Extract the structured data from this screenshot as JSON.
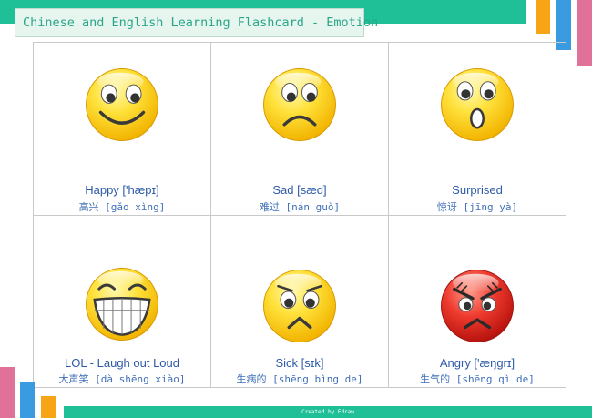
{
  "theme": {
    "teal": "#1fbf98",
    "orange": "#f7a517",
    "blue": "#3b9be0",
    "pink": "#e0729a"
  },
  "title": "Chinese and English Learning Flashcard - Emotion",
  "footer": "Created by Edraw",
  "cards": [
    {
      "icon": "happy-face-icon",
      "english": "Happy ['hæpɪ]",
      "chinese": "高兴 [gǎo xìng]"
    },
    {
      "icon": "sad-face-icon",
      "english": "Sad [sæd]",
      "chinese": "难过 [nán guò]"
    },
    {
      "icon": "surprised-face-icon",
      "english": "Surprised",
      "chinese": "惊讶 [jīng yà]"
    },
    {
      "icon": "laughing-face-icon",
      "english": "LOL - Laugh out Loud",
      "chinese": "大声笑 [dà shēng xiào]"
    },
    {
      "icon": "sick-face-icon",
      "english": "Sick  [sɪk]",
      "chinese": "生病的 [shēng bìng de]"
    },
    {
      "icon": "angry-face-icon",
      "english": "Angry ['æŋgrɪ]",
      "chinese": "生气的 [shēng qì de]"
    }
  ]
}
